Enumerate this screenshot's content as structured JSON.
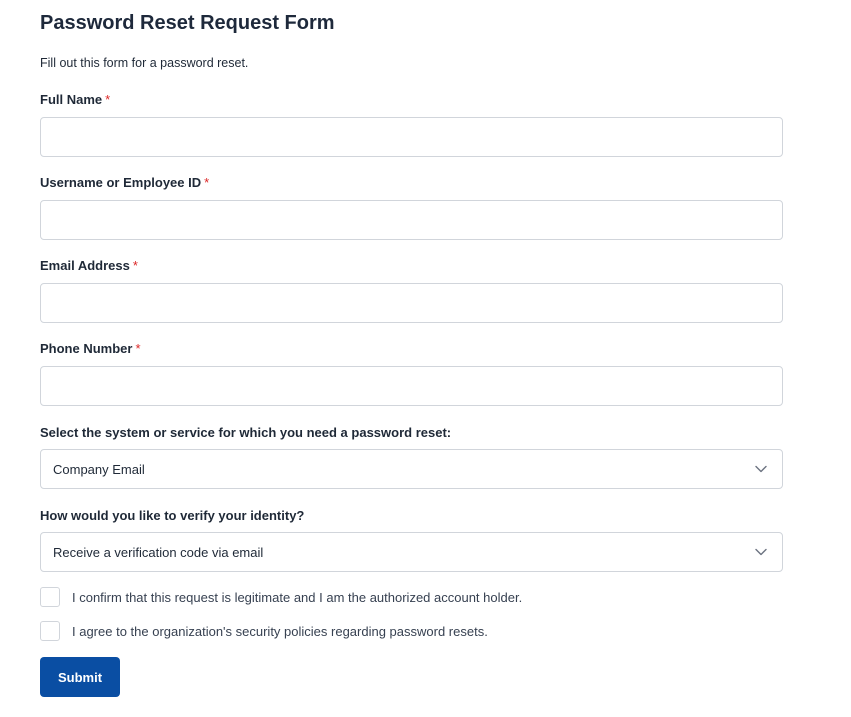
{
  "form": {
    "title": "Password Reset Request Form",
    "subtitle": "Fill out this form for a password reset.",
    "required_marker": "*",
    "fields": {
      "full_name": {
        "label": "Full Name",
        "value": ""
      },
      "username": {
        "label": "Username or Employee ID",
        "value": ""
      },
      "email": {
        "label": "Email Address",
        "value": ""
      },
      "phone": {
        "label": "Phone Number",
        "value": ""
      }
    },
    "system_select": {
      "label": "Select the system or service for which you need a password reset:",
      "selected": "Company Email"
    },
    "verify_select": {
      "label": "How would you like to verify your identity?",
      "selected": "Receive a verification code via email"
    },
    "checkboxes": {
      "confirm": {
        "label": "I confirm that this request is legitimate and I am the authorized account holder.",
        "checked": false
      },
      "agree": {
        "label": "I agree to the organization's security policies regarding password resets.",
        "checked": false
      }
    },
    "submit_label": "Submit"
  },
  "colors": {
    "primary": "#0a4ea3",
    "required": "#dc2626",
    "border": "#d1d5db"
  },
  "icons": {
    "select_chevron": "chevron-down-icon"
  }
}
